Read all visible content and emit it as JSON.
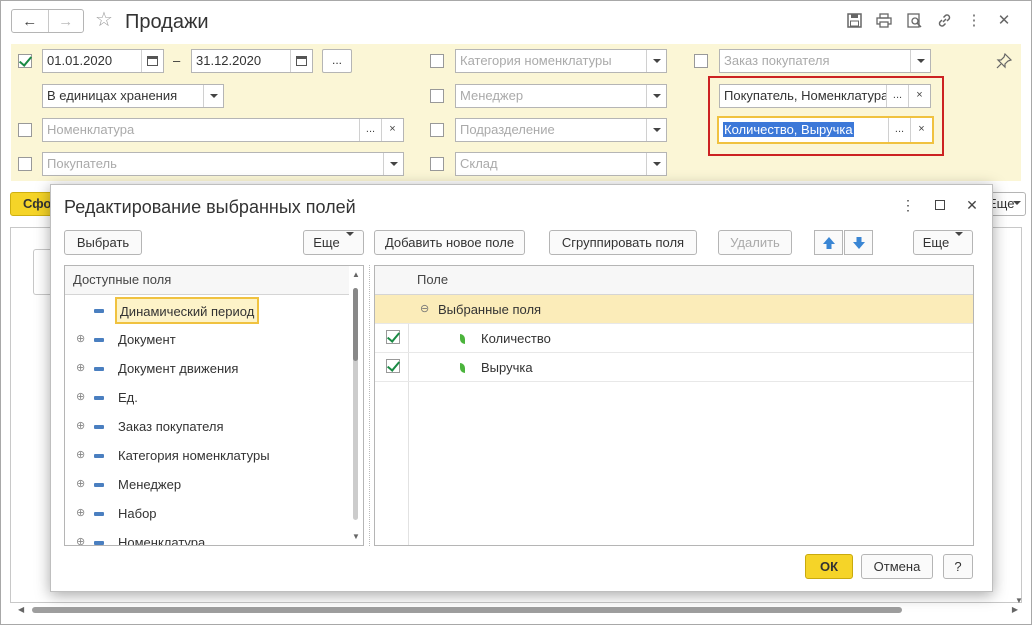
{
  "window": {
    "title": "Продажи"
  },
  "filters": {
    "date_from": "01.01.2020",
    "date_sep": "–",
    "date_to": "31.12.2020",
    "date_more": "...",
    "units": "В единицах хранения",
    "nomenclature_ph": "Номенклатура",
    "buyer_ph": "Покупатель",
    "category_ph": "Категория номенклатуры",
    "manager_ph": "Менеджер",
    "division_ph": "Подразделение",
    "warehouse_ph": "Склад",
    "order_ph": "Заказ покупателя",
    "grouping_value": "Покупатель, Номенклатура",
    "fields_value": "Количество, Выручка",
    "more": "...",
    "clear": "×"
  },
  "toolbar": {
    "form_label": "Сформировать",
    "more_label": "Еще"
  },
  "dialog": {
    "title": "Редактирование выбранных полей",
    "select_btn": "Выбрать",
    "more_btn": "Еще",
    "add_field_btn": "Добавить новое поле",
    "group_fields_btn": "Сгруппировать поля",
    "delete_btn": "Удалить",
    "more_btn2": "Еще",
    "ok_btn": "ОК",
    "cancel_btn": "Отмена",
    "help_btn": "?",
    "available": {
      "header": "Доступные поля",
      "items": [
        "Динамический период",
        "Документ",
        "Документ движения",
        "Ед.",
        "Заказ покупателя",
        "Категория номенклатуры",
        "Менеджер",
        "Набор",
        "Номенклатура"
      ]
    },
    "selected": {
      "header": "Поле",
      "group": "Выбранные поля",
      "items": [
        "Количество",
        "Выручка"
      ]
    }
  },
  "colors": {
    "filter_bg": "#fbf6d6",
    "accent_yellow": "#f5d428",
    "highlight_red": "#cc2222",
    "check_green": "#1a8a44"
  }
}
